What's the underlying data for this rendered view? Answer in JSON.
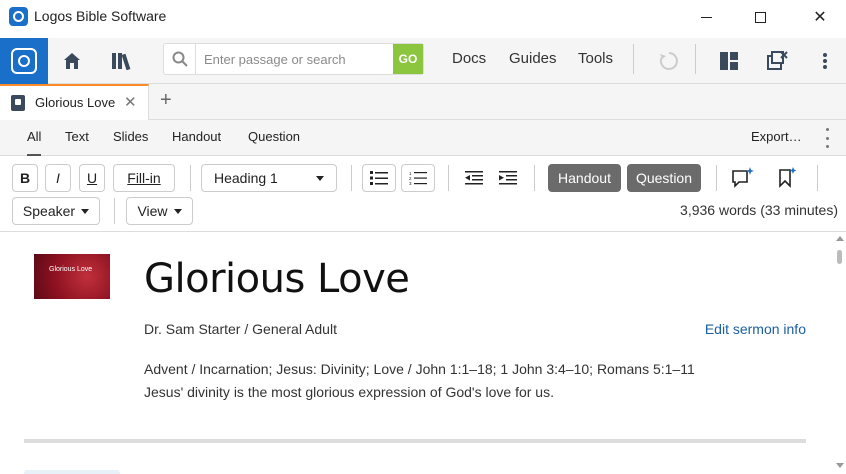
{
  "window": {
    "title": "Logos Bible Software",
    "minimize": "minimize-icon",
    "maximize": "maximize-icon",
    "close": "✕"
  },
  "toolbar": {
    "search_placeholder": "Enter passage or search",
    "search_value": "",
    "go_label": "GO",
    "links": [
      "Docs",
      "Guides",
      "Tools"
    ],
    "brand_color": "#1a6fc9",
    "go_color": "#8cc63f"
  },
  "tabs": {
    "active_label": "Glorious Love",
    "close": "✕",
    "new_tab": "+",
    "accent_color": "#ff8a2a"
  },
  "filter": {
    "items": [
      "All",
      "Text",
      "Slides",
      "Handout",
      "Question"
    ],
    "active": "All",
    "export_label": "Export…"
  },
  "format": {
    "bold": "B",
    "italic": "I",
    "underline": "U",
    "fill_in": "Fill-in",
    "style_select": "Heading 1",
    "handout": "Handout",
    "question": "Question",
    "speaker": "Speaker",
    "view": "View",
    "word_count": "3,936 words (33 minutes)"
  },
  "document": {
    "thumbnail_text": "Glorious Love",
    "title": "Glorious Love",
    "author_line": "Dr. Sam Starter / General Adult",
    "edit_link": "Edit sermon info",
    "tags_line": "Advent / Incarnation; Jesus: Divinity; Love / John 1:1–18; 1 John 3:4–10; Romans 5:1–11",
    "summary": "Jesus' divinity is the most glorious expression of God's love for us."
  }
}
